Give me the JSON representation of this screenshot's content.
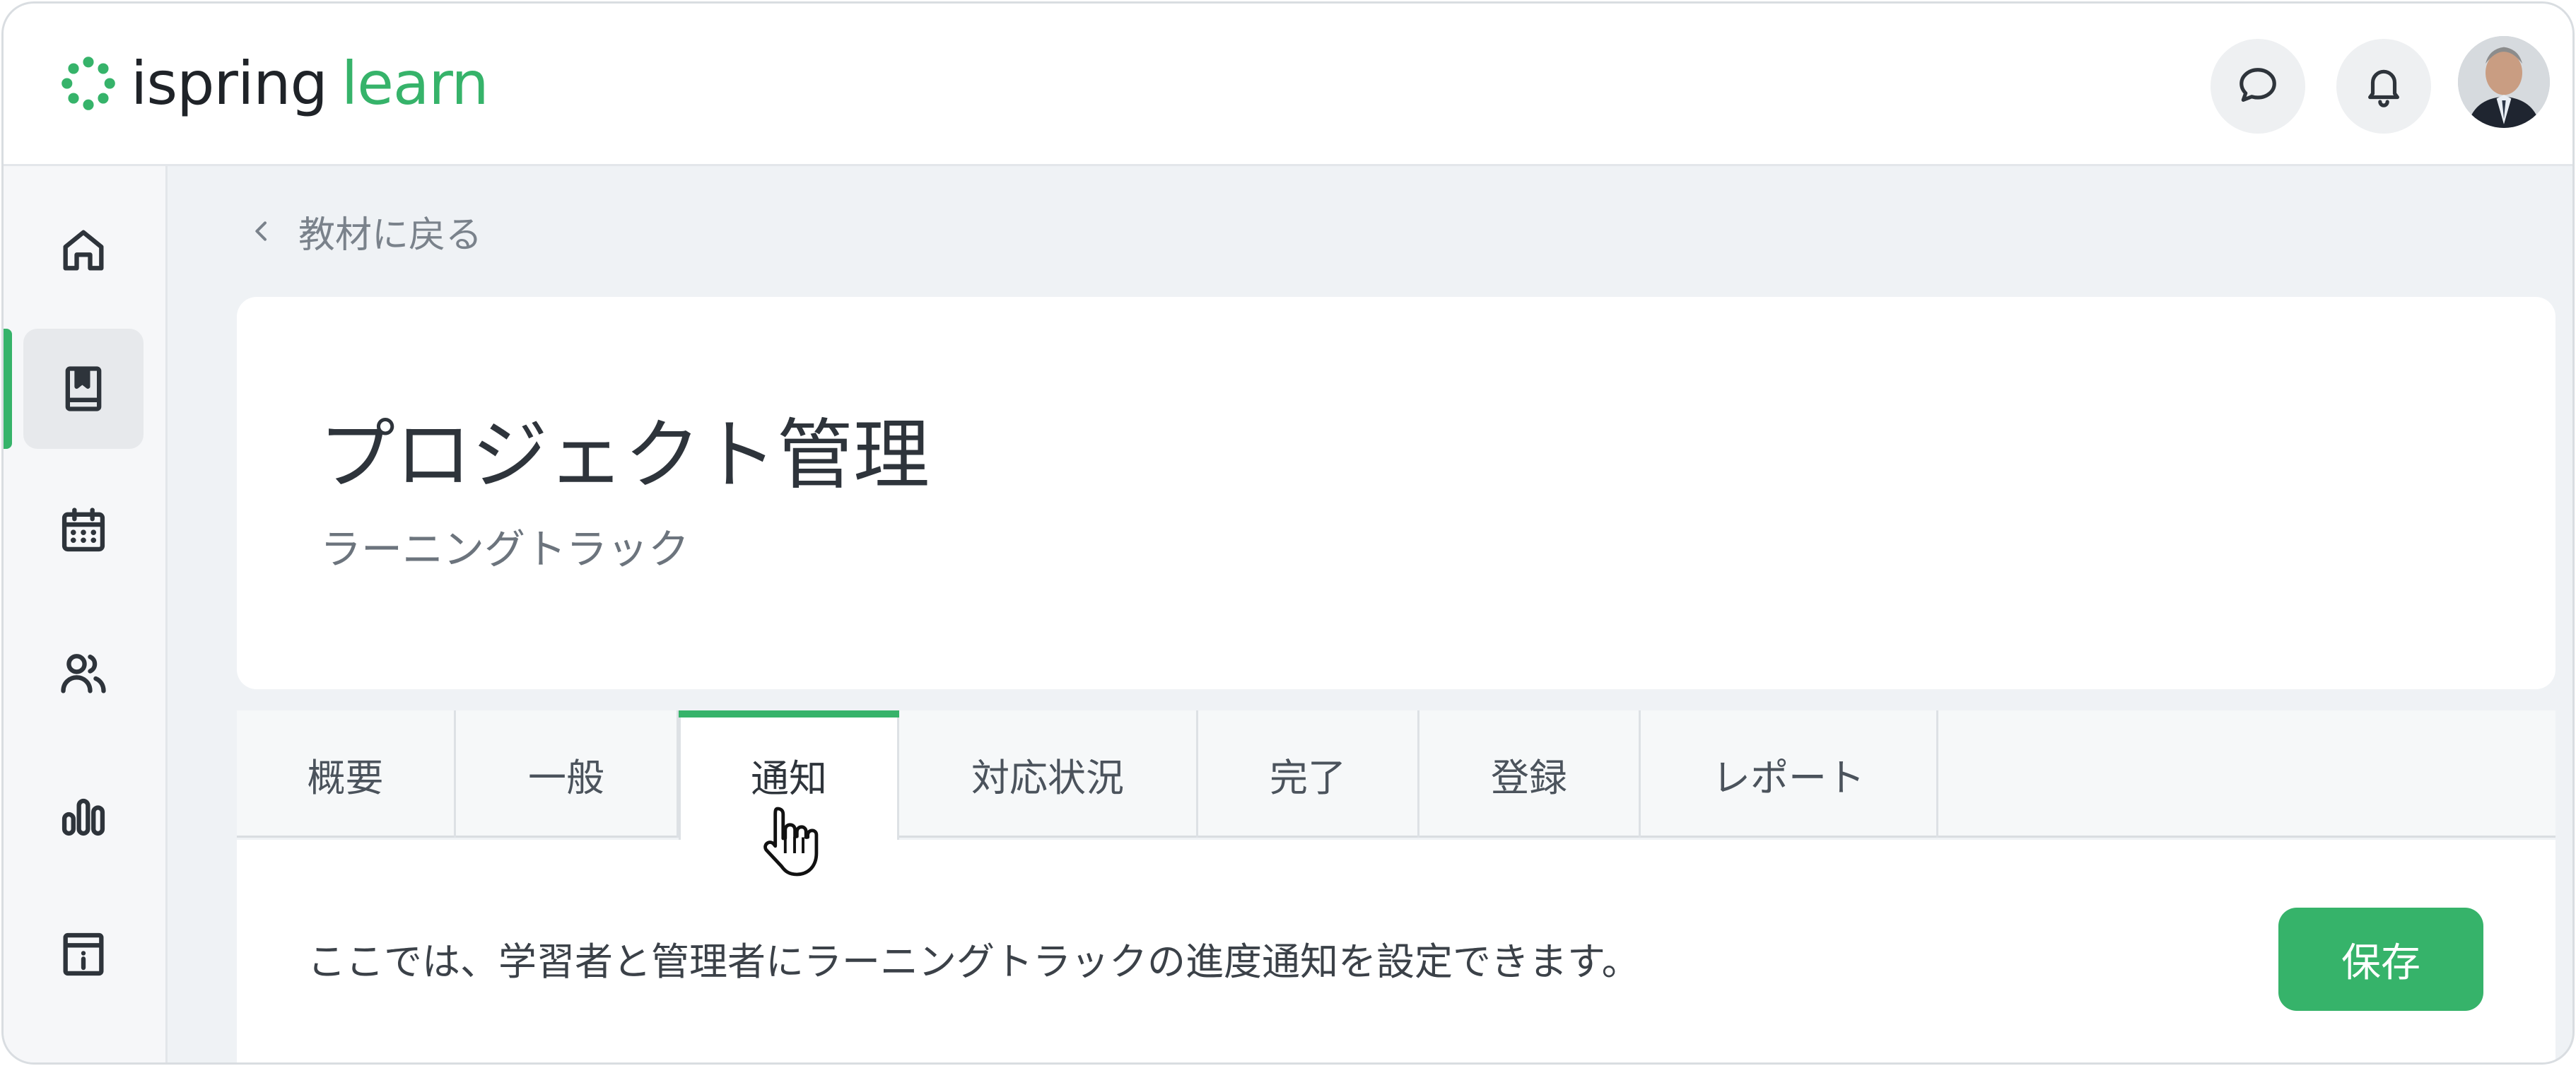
{
  "app": {
    "logo_primary": "ispring",
    "logo_secondary": "learn",
    "brand_color": "#36b36a"
  },
  "header": {
    "chat_icon": "chat-bubble-icon",
    "bell_icon": "bell-icon",
    "avatar_icon": "user-avatar"
  },
  "sidebar": {
    "items": [
      {
        "icon": "home-icon",
        "active": false
      },
      {
        "icon": "book-icon",
        "active": true
      },
      {
        "icon": "calendar-icon",
        "active": false
      },
      {
        "icon": "users-icon",
        "active": false
      },
      {
        "icon": "bar-chart-icon",
        "active": false
      },
      {
        "icon": "info-icon",
        "active": false
      }
    ]
  },
  "breadcrumb": {
    "back_label": "教材に戻る"
  },
  "course": {
    "title": "プロジェクト管理",
    "type": "ラーニングトラック"
  },
  "tabs": [
    {
      "label": "概要"
    },
    {
      "label": "一般"
    },
    {
      "label": "通知",
      "active": true
    },
    {
      "label": "対応状況"
    },
    {
      "label": "完了"
    },
    {
      "label": "登録"
    },
    {
      "label": "レポート"
    }
  ],
  "notifications": {
    "description": "ここでは、学習者と管理者にラーニングトラックの進度通知を設定できます。",
    "save_label": "保存"
  }
}
